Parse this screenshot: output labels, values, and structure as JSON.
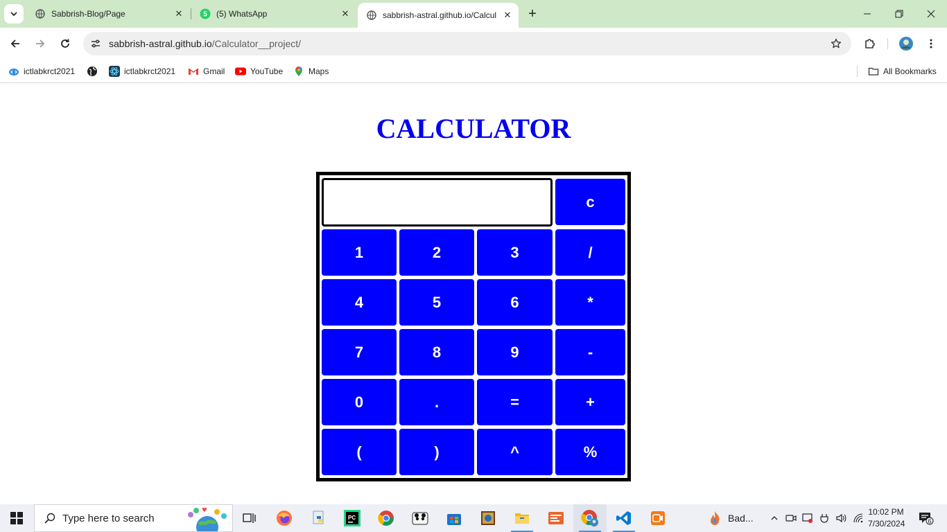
{
  "browser": {
    "tabs": [
      {
        "title": "Sabbrish-Blog/Page"
      },
      {
        "title": "(5) WhatsApp"
      },
      {
        "title": "sabbrish-astral.github.io/Calcul"
      }
    ],
    "whatsapp_badge": "5",
    "url_host": "sabbrish-astral.github.io",
    "url_path": "/Calculator__project/",
    "bookmarks": [
      {
        "label": "ictlabkrct2021"
      },
      {
        "label": ""
      },
      {
        "label": "ictlabkrct2021"
      },
      {
        "label": "Gmail"
      },
      {
        "label": "YouTube"
      },
      {
        "label": "Maps"
      }
    ],
    "all_bookmarks": "All Bookmarks"
  },
  "page": {
    "title": "CALCULATOR",
    "display_value": "",
    "keys": {
      "clear": "c",
      "k1": "1",
      "k2": "2",
      "k3": "3",
      "div": "/",
      "k4": "4",
      "k5": "5",
      "k6": "6",
      "mul": "*",
      "k7": "7",
      "k8": "8",
      "k9": "9",
      "sub": "-",
      "k0": "0",
      "dot": ".",
      "eq": "=",
      "add": "+",
      "lparen": "(",
      "rparen": ")",
      "pow": "^",
      "mod": "%"
    }
  },
  "taskbar": {
    "search_placeholder": "Type here to search",
    "running_app_label": "Bad...",
    "time": "10:02 PM",
    "date": "7/30/2024",
    "notification_count": "6"
  },
  "colors": {
    "key_bg": "#0000ff",
    "title": "#0000ee",
    "tabstrip": "#cfe8c8"
  }
}
